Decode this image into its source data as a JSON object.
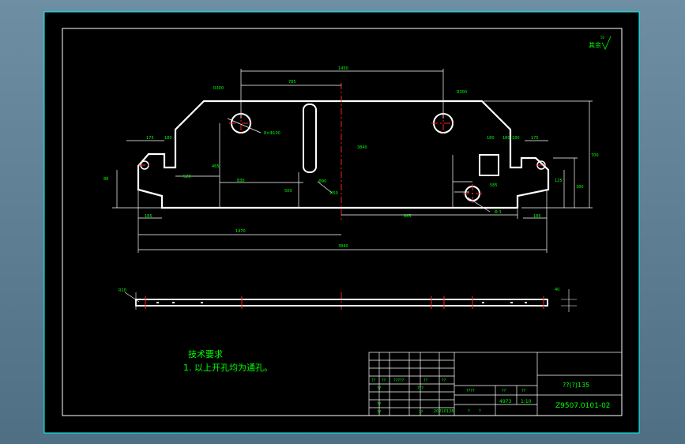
{
  "technical_requirements": {
    "title": "技术要求",
    "item1": "1. 以上开孔均为通孔。"
  },
  "roughness_mark": "其余",
  "roughness_value": "50",
  "dimensions": {
    "top_total": "1450",
    "top_left": "785",
    "corner_left": "R300",
    "corner_right": "R300",
    "hole_label": "8×Φ100",
    "center_label": "3840",
    "overall_bottom": "3840",
    "left_part": "1470",
    "right_part": "865",
    "right_height": "700",
    "right_height2": "380",
    "slot_label": "Φ90",
    "slot_r": "R50",
    "bottom_small": "Φ 3",
    "side_label": "R10",
    "left_top": "175",
    "left_top2": "180",
    "right_top": "175",
    "right_top2": "180",
    "right_mid1": "180",
    "right_mid2": "180",
    "inner_height": "465",
    "left_low1": "185",
    "right_low1": "185",
    "left_inner": "520",
    "left_inner2": "830",
    "b_left": "500",
    "b_center": "585",
    "side_dim": "88",
    "side_dim2": "125",
    "thick": "40"
  },
  "title_block": {
    "part_name": "??(?)135",
    "drawing_no": "Z9507.0101-02",
    "weight": "4973",
    "scale": "1:10",
    "date": "20210128",
    "cells": [
      "??",
      "??",
      "?????",
      "??",
      "??",
      "??",
      "???",
      "????",
      "??",
      "??",
      "??",
      "??",
      "??",
      "?",
      "?"
    ]
  }
}
